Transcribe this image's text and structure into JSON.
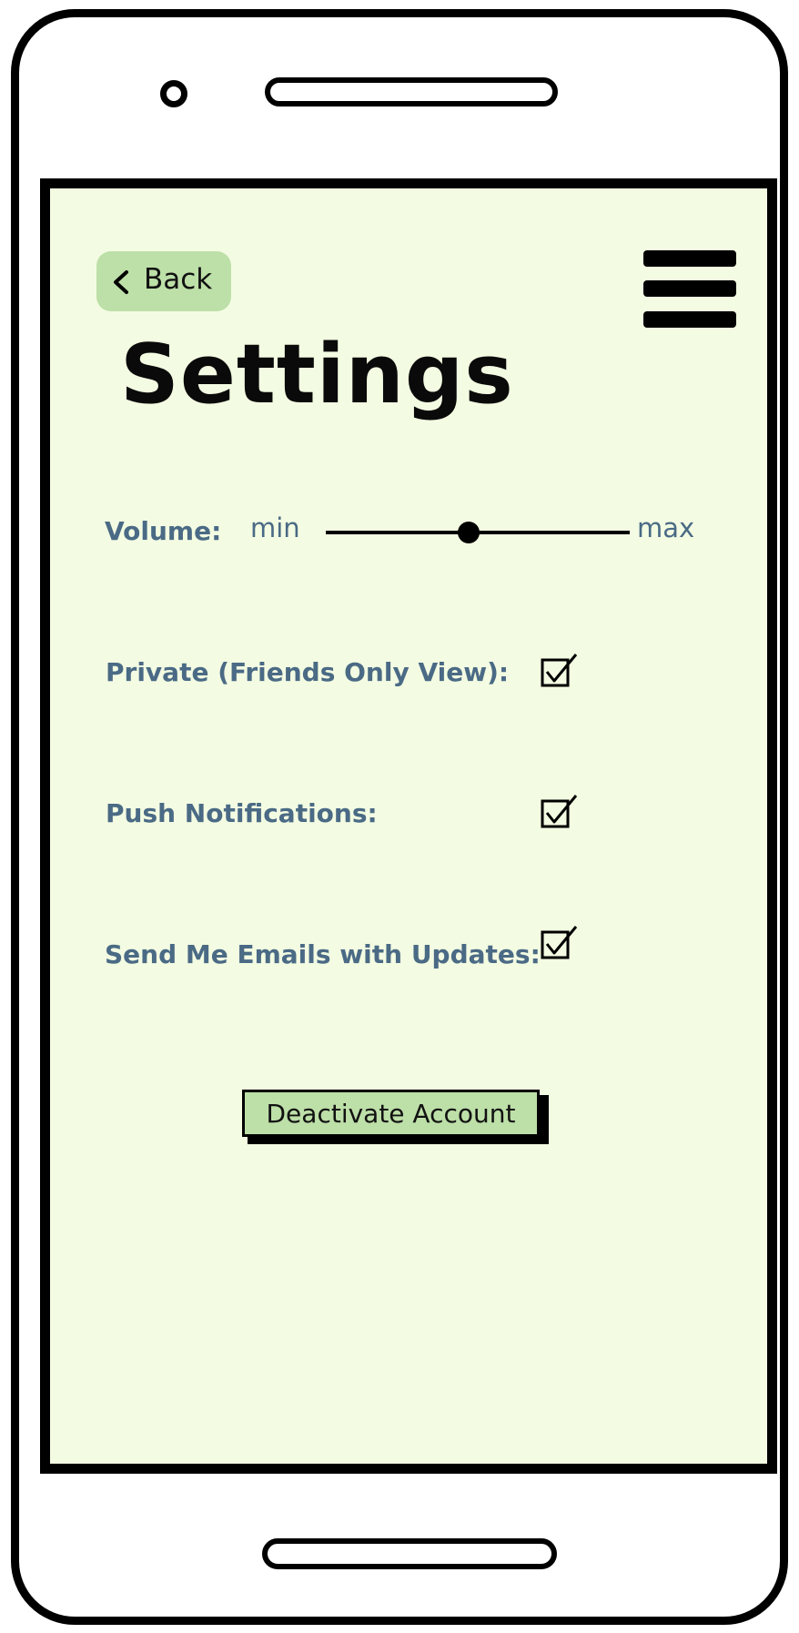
{
  "header": {
    "back_label": "Back",
    "title": "Settings"
  },
  "volume": {
    "label": "Volume:",
    "min_label": "min",
    "max_label": "max",
    "level": 0.47
  },
  "toggles": [
    {
      "label": "Private (Friends Only View):",
      "checked": true
    },
    {
      "label": "Push Notifications:",
      "checked": true
    },
    {
      "label": "Send Me Emails with Updates:",
      "checked": true
    }
  ],
  "actions": {
    "deactivate_label": "Deactivate Account"
  },
  "colors": {
    "screen_background": "#f3fce2",
    "button_fill": "#bddfa8",
    "label_text": "#4a6a85"
  }
}
